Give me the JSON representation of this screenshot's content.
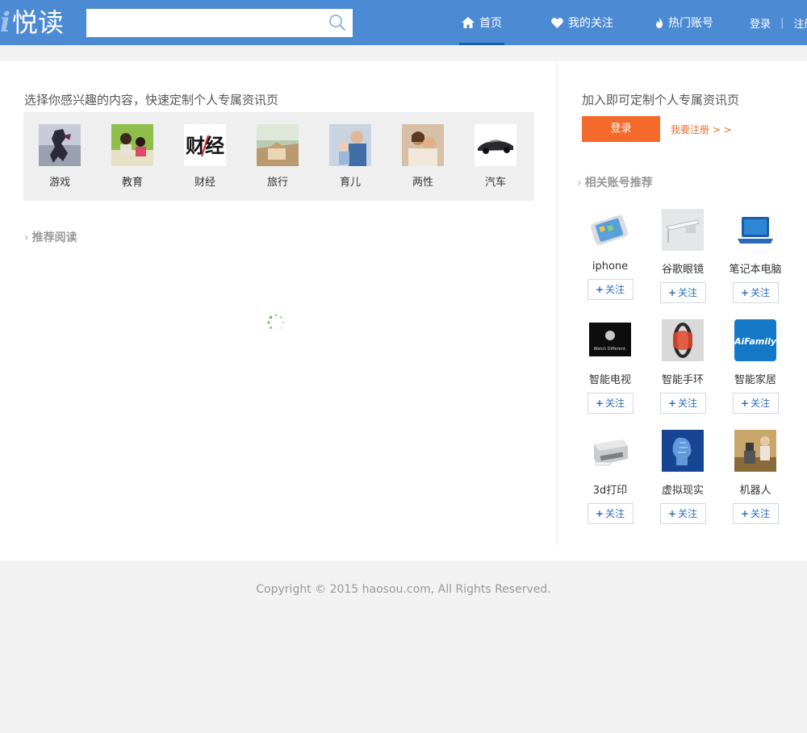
{
  "header": {
    "logo_mark": "i",
    "logo_text": "悦读",
    "search_placeholder": "",
    "nav": [
      {
        "label": "首页",
        "icon": "home-icon"
      },
      {
        "label": "我的关注",
        "icon": "heart-icon"
      },
      {
        "label": "热门账号",
        "icon": "flame-icon"
      }
    ],
    "login": "登录",
    "separator": "|",
    "register": "注册"
  },
  "categories": {
    "intro": "选择你感兴趣的内容，快速定制个人专属资讯页",
    "items": [
      {
        "label": "游戏"
      },
      {
        "label": "教育"
      },
      {
        "label": "财经",
        "thumb_text": "财经"
      },
      {
        "label": "旅行"
      },
      {
        "label": "育儿"
      },
      {
        "label": "两性"
      },
      {
        "label": "汽车"
      }
    ]
  },
  "recommend": {
    "title": "推荐阅读"
  },
  "sidebar": {
    "join_text": "加入即可定制个人专属资讯页",
    "login_button": "登录",
    "register_link": "我要注册 > >",
    "accounts_title": "相关账号推荐",
    "follow_label": "关注",
    "accounts": [
      {
        "name": "iphone"
      },
      {
        "name": "谷歌眼镜"
      },
      {
        "name": "笔记本电脑"
      },
      {
        "name": "智能电视",
        "thumb_text": "Watch Different."
      },
      {
        "name": "智能手环"
      },
      {
        "name": "智能家居",
        "thumb_text": "AiFamily"
      },
      {
        "name": "3d打印"
      },
      {
        "name": "虚拟现实"
      },
      {
        "name": "机器人"
      }
    ]
  },
  "footer": {
    "copyright": "Copyright © 2015 haosou.com, All Rights Reserved."
  },
  "colors": {
    "header_bg": "#4c8ad4",
    "accent_orange": "#f56a2a",
    "follow_blue": "#2e6fbf"
  }
}
